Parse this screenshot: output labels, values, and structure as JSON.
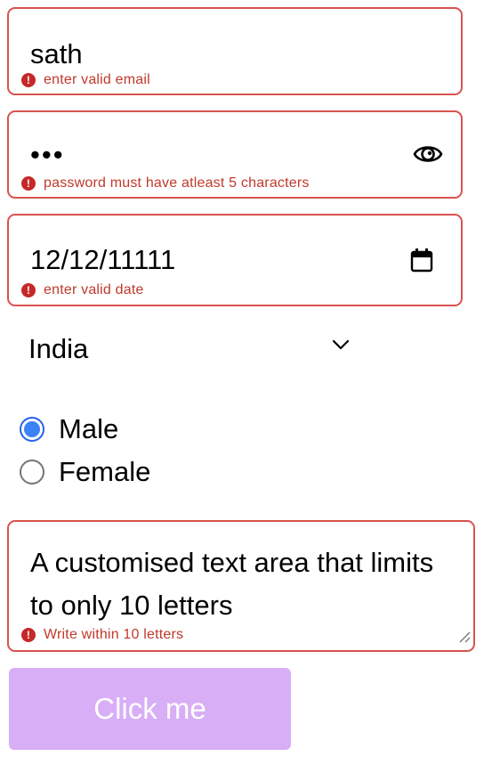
{
  "email": {
    "value": "sath",
    "error": "enter valid email"
  },
  "password": {
    "value": "•••",
    "error": "password must have atleast 5 characters",
    "toggle_icon": "eye-icon"
  },
  "date": {
    "value": "12/12/11111",
    "error": "enter valid date",
    "picker_icon": "calendar-icon"
  },
  "country": {
    "selected": "India",
    "icon": "chevron-down-icon"
  },
  "gender": {
    "options": [
      {
        "label": "Male",
        "checked": true
      },
      {
        "label": "Female",
        "checked": false
      }
    ]
  },
  "message": {
    "value": "A customised text area that limits to only 10 letters",
    "error": "Write within 10 letters"
  },
  "submit": {
    "label": "Click me"
  },
  "colors": {
    "error_border": "#d9534f",
    "error_text": "#c0392b",
    "radio_accent": "#3b82f6",
    "button_bg": "#d8aef7",
    "button_text": "#ffffff"
  }
}
